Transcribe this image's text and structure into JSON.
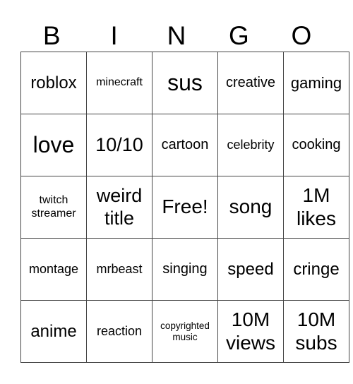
{
  "header": [
    "B",
    "I",
    "N",
    "G",
    "O"
  ],
  "rows": [
    [
      "roblox",
      "minecraft",
      "sus",
      "creative",
      "gaming"
    ],
    [
      "love",
      "10/10",
      "cartoon",
      "celebrity",
      "cooking"
    ],
    [
      "twitch streamer",
      "weird title",
      "Free!",
      "song",
      "1M likes"
    ],
    [
      "montage",
      "mrbeast",
      "singing",
      "speed",
      "cringe"
    ],
    [
      "anime",
      "reaction",
      "copyrighted music",
      "10M views",
      "10M subs"
    ]
  ]
}
